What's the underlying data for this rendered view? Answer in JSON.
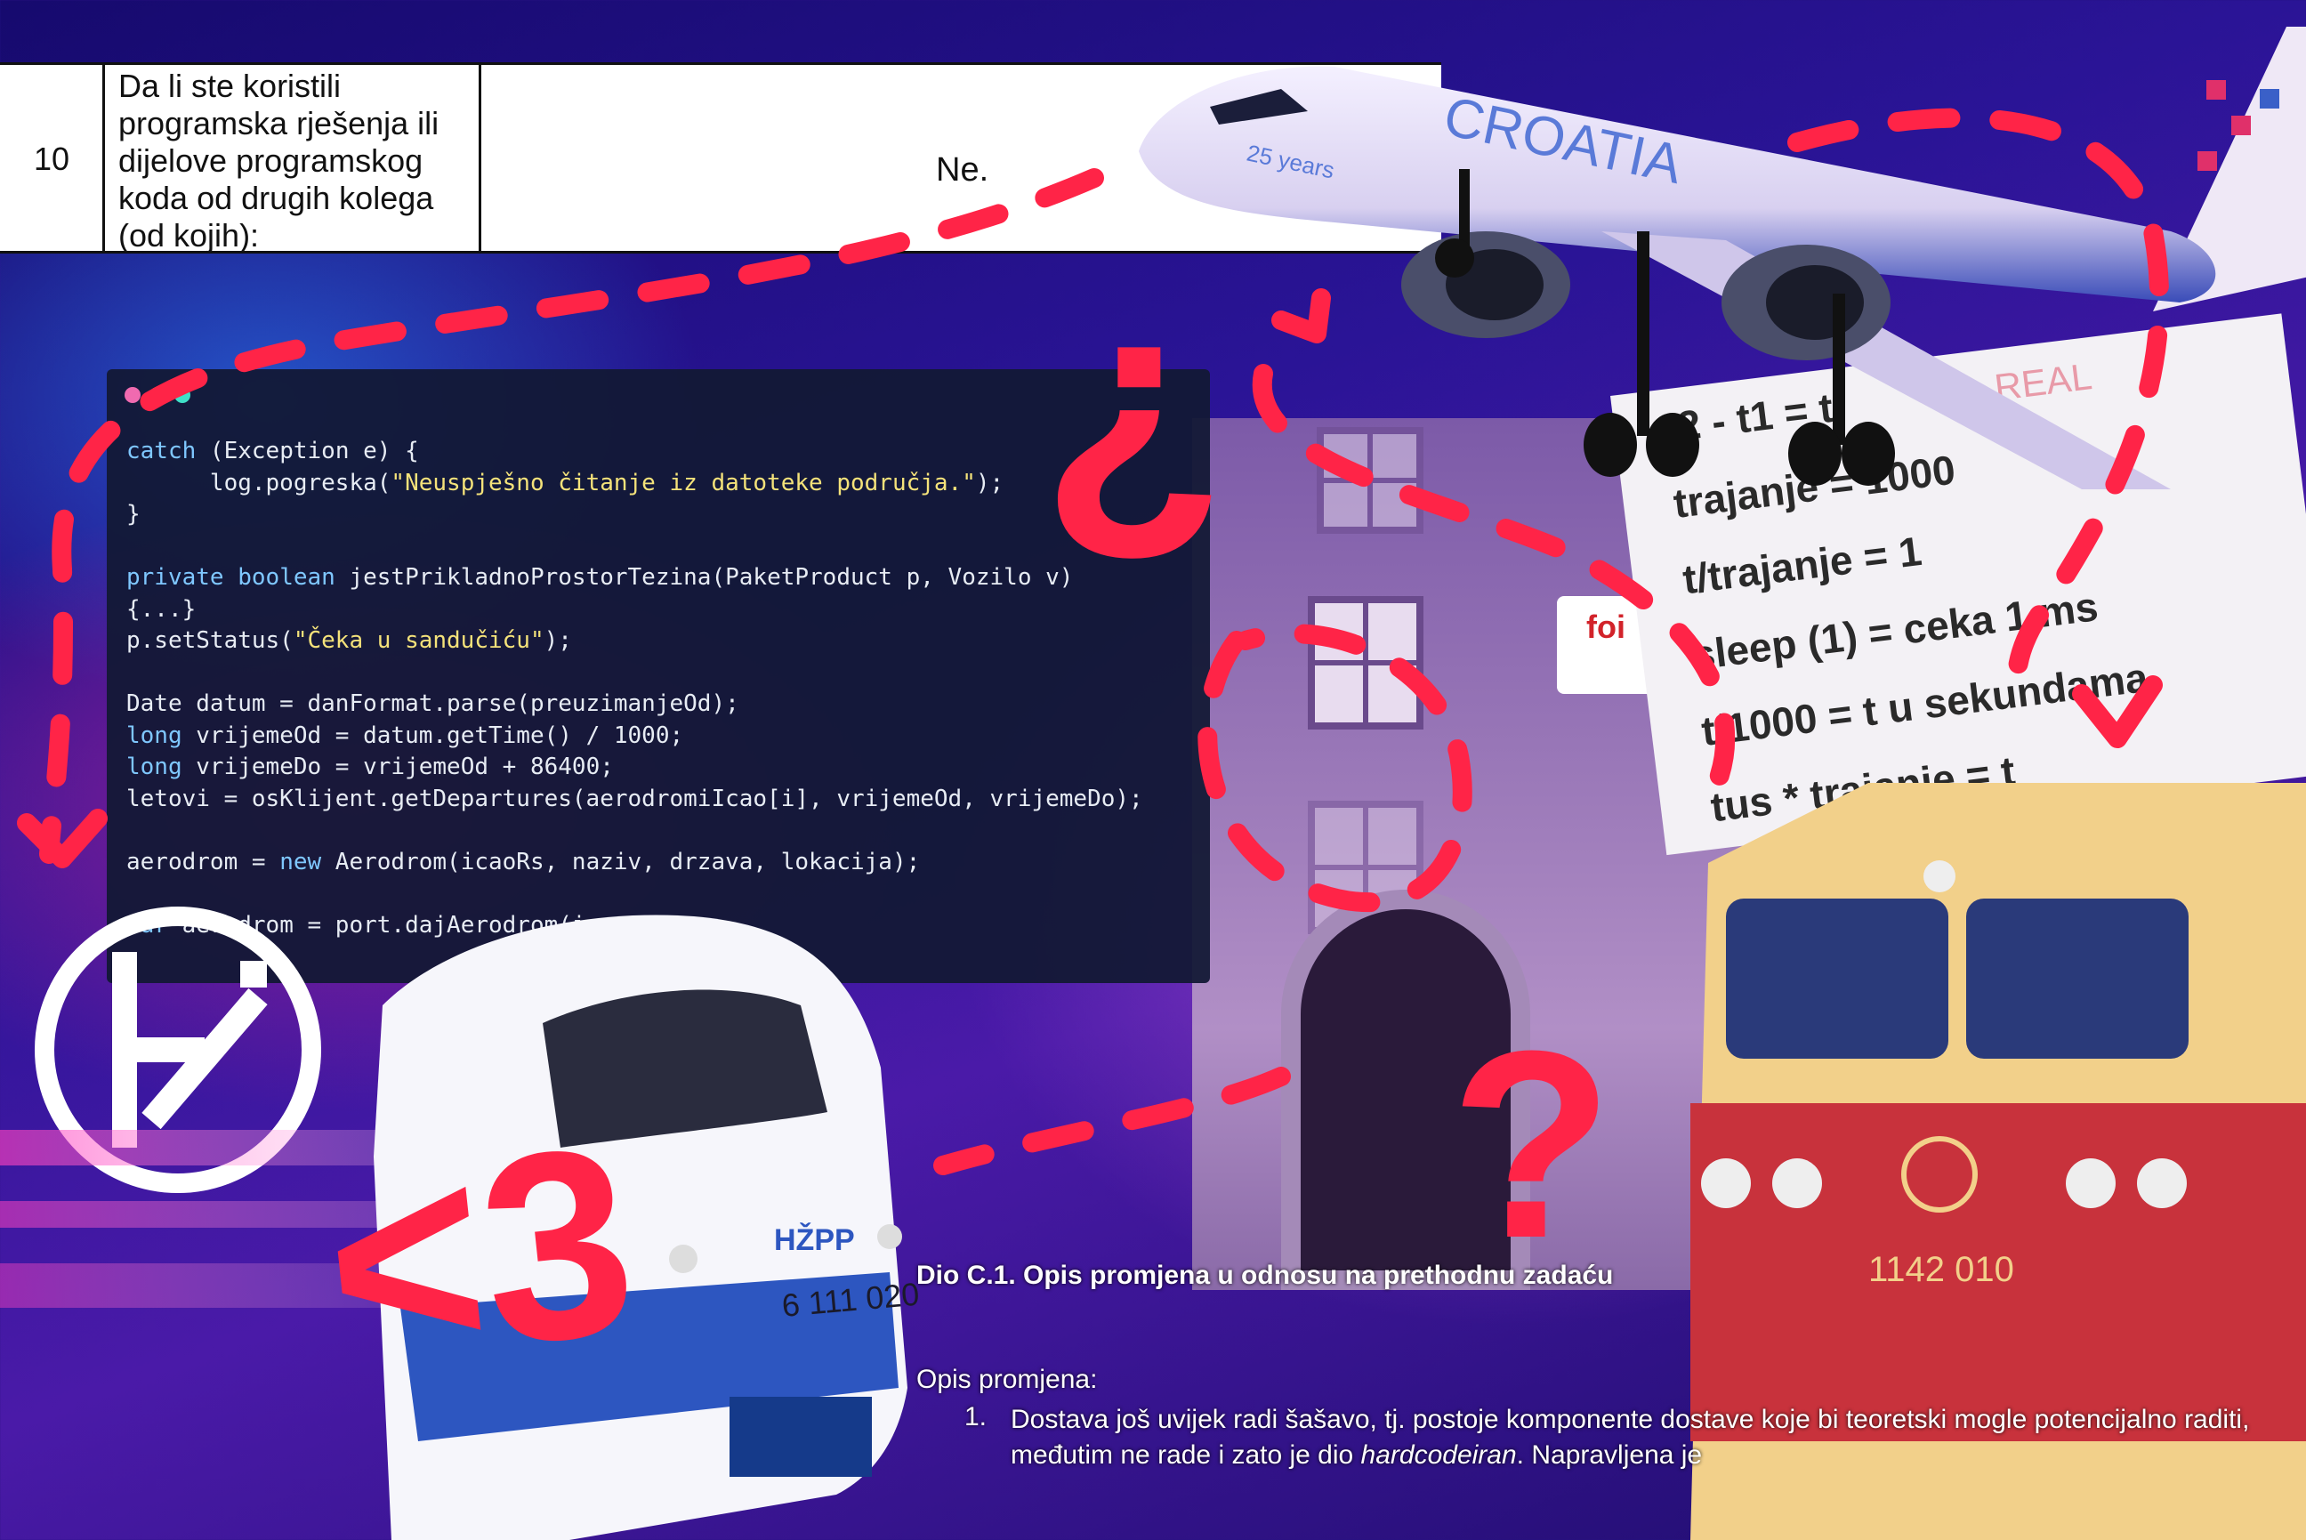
{
  "table_row": {
    "number": "10",
    "question": "Da li ste koristili\nprogramska rješenja ili\ndijelove programskog\nkoda od drugih kolega\n(od kojih):",
    "answer": "Ne."
  },
  "code_lines": [
    "catch (Exception e) {",
    "      log.pogreska(\"Neuspješno čitanje iz datoteke područja.\");",
    "}",
    "",
    "private boolean jestPrikladnoProstorTezina(PaketProduct p, Vozilo v)",
    "{...}",
    "p.setStatus(\"Čeka u sandučiću\");",
    "",
    "Date datum = danFormat.parse(preuzimanjeOd);",
    "long vrijemeOd = datum.getTime() / 1000;",
    "long vrijemeDo = vrijemeOd + 86400;",
    "letovi = osKlijent.getDepartures(aerodromiIcao[i], vrijemeOd, vrijemeDo);",
    "",
    "aerodrom = new Aerodrom(icaoRs, naziv, drzava, lokacija);",
    "",
    "var aerodrom = port.dajAerodrom(i"
  ],
  "note_lines": [
    "t2 - t1  = t",
    "trajanje = 1000",
    "t/trajanje = 1",
    "sleep (1) = ceka 1 ms",
    "t/1000 = t u sekundama",
    "tus * trajanje = t"
  ],
  "note_faded": "REAL",
  "plane_livery": "CROATIA",
  "plane_badge": "25 years",
  "train_front": {
    "brand": "HŽPP",
    "number": "6 111 020"
  },
  "train_right": {
    "number": "1142 010"
  },
  "building_sign": "foi",
  "doodles": {
    "question_mark": "?",
    "inverted_question": "¿",
    "heart": "<3"
  },
  "doc": {
    "heading": "Dio C.1. Opis promjena u odnosu na prethodnu zadaću",
    "label": "Opis promjena:",
    "item_number": "1.",
    "item_text_1": "Dostava još uvijek radi šašavo, tj. postoje komponente dostave koje bi teoretski mogle potencijalno raditi, međutim ne rade i zato je dio ",
    "item_italic": "hardcodeiran",
    "item_text_2": ". Napravljena je"
  },
  "colors": {
    "doodle_red": "#ff2447",
    "code_bg": "#12183a",
    "dot_pink": "#f06ab0",
    "dot_yellow": "#f5d94a",
    "dot_teal": "#3fe0c8"
  }
}
